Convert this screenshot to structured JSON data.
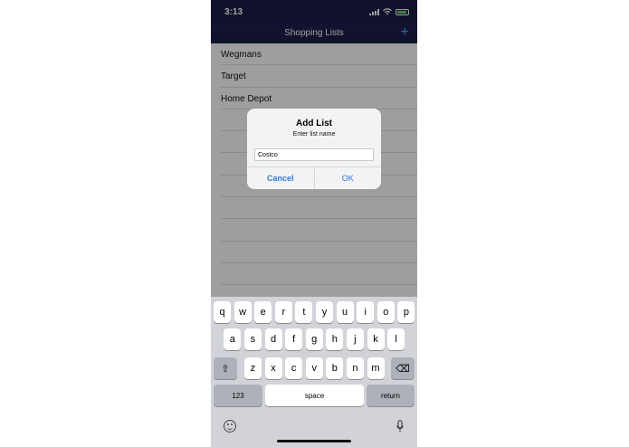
{
  "status": {
    "time": "3:13"
  },
  "nav": {
    "title": "Shopping Lists",
    "add_label": "+"
  },
  "lists": [
    "Wegmans",
    "Target",
    "Home Depot"
  ],
  "alert": {
    "title": "Add List",
    "message": "Enter list name",
    "input_value": "Costco",
    "cancel": "Cancel",
    "ok": "OK"
  },
  "keyboard": {
    "row1": [
      "q",
      "w",
      "e",
      "r",
      "t",
      "y",
      "u",
      "i",
      "o",
      "p"
    ],
    "row2": [
      "a",
      "s",
      "d",
      "f",
      "g",
      "h",
      "j",
      "k",
      "l"
    ],
    "row3": [
      "z",
      "x",
      "c",
      "v",
      "b",
      "n",
      "m"
    ],
    "shift": "⇧",
    "delete": "⌫",
    "numbers": "123",
    "space": "space",
    "return": "return"
  },
  "colors": {
    "nav_bg": "#1b1d47",
    "accent": "#2f7bdc",
    "battery": "#5fd35c"
  }
}
